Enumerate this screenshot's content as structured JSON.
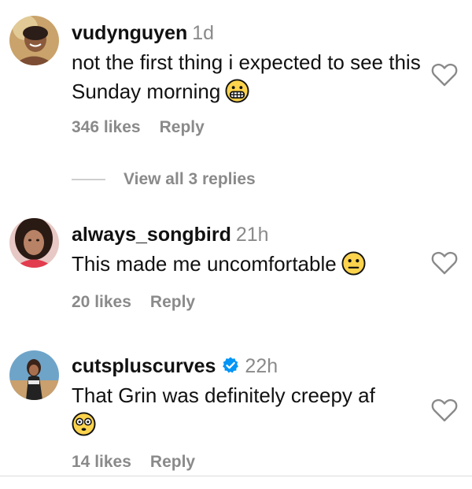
{
  "comments": [
    {
      "username": "vudynguyen",
      "time": "1d",
      "verified": false,
      "text": "not the first thing i expected to see this Sunday morning",
      "emoji": "grimacing-face",
      "likes": "346 likes",
      "reply": "Reply",
      "view_replies": "View all 3 replies"
    },
    {
      "username": "always_songbird",
      "time": "21h",
      "verified": false,
      "text": "This made me uncomfortable",
      "emoji": "neutral-face",
      "likes": "20 likes",
      "reply": "Reply"
    },
    {
      "username": "cutspluscurves",
      "time": "22h",
      "verified": true,
      "text": "That Grin was definitely creepy af",
      "emoji": "flushed-face",
      "likes": "14 likes",
      "reply": "Reply"
    }
  ],
  "colors": {
    "text": "#111111",
    "muted": "#8a8a8a",
    "verified_blue": "#0095f6",
    "emoji_yellow": "#fcd34d"
  },
  "icons": {
    "like": "heart-outline-icon",
    "verified": "verified-badge-icon"
  }
}
